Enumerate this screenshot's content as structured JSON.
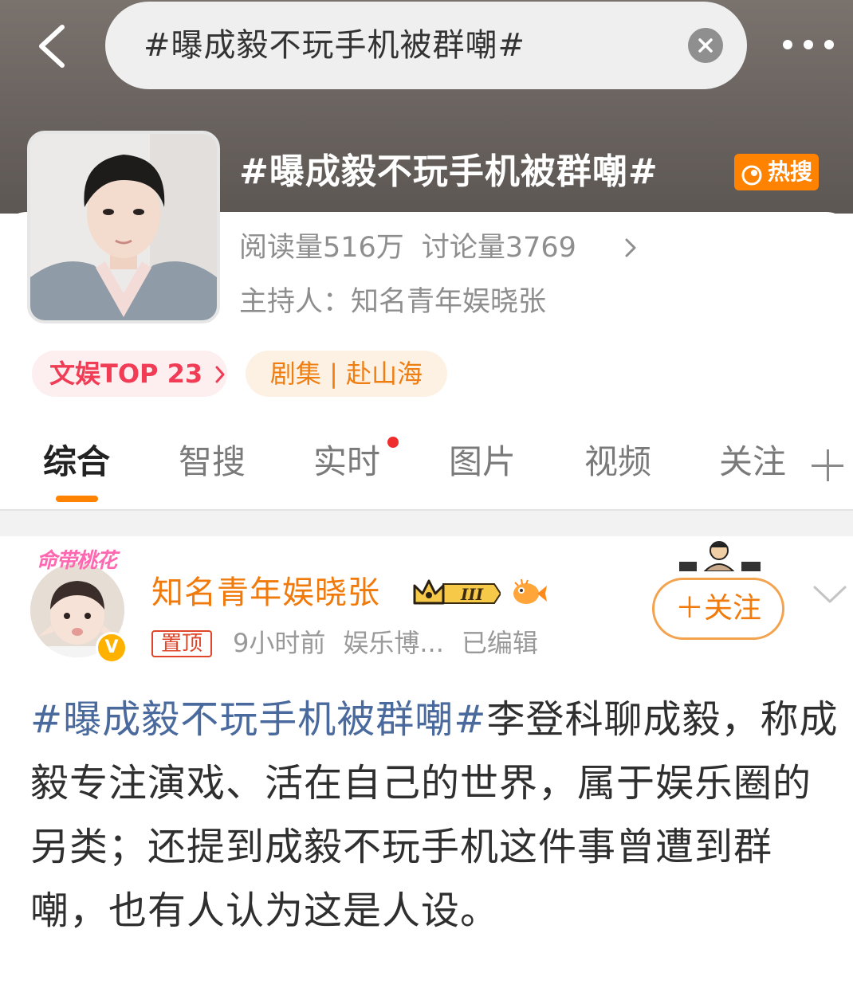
{
  "search": {
    "query": "#曝成毅不玩手机被群嘲#"
  },
  "topic": {
    "title": "#曝成毅不玩手机被群嘲#",
    "badge": "热搜",
    "reads": "阅读量516万",
    "discussions": "讨论量3769",
    "host": "主持人：知名青年娱晓张"
  },
  "pills": {
    "rank": "文娱TOP 23",
    "drama": "剧集 | 赴山海"
  },
  "tabs": [
    "综合",
    "智搜",
    "实时",
    "图片",
    "视频",
    "关注"
  ],
  "post": {
    "avatar_frame_text": "命带桃花",
    "author": "知名青年娱晓张",
    "level": "III",
    "pin": "置顶",
    "time": "9小时前",
    "source": "娱乐博...",
    "edited": "已编辑",
    "follow": "＋关注",
    "hashtag": "#曝成毅不玩手机被群嘲#",
    "body": "李登科聊成毅，称成毅专注演戏、活在自己的世界，属于娱乐圈的另类；还提到成毅不玩手机这件事曾遭到群嘲，也有人认为这是人设。"
  },
  "colors": {
    "accent": "#ff8200",
    "hashtag": "#4a6a9d",
    "author": "#f07a0c"
  }
}
